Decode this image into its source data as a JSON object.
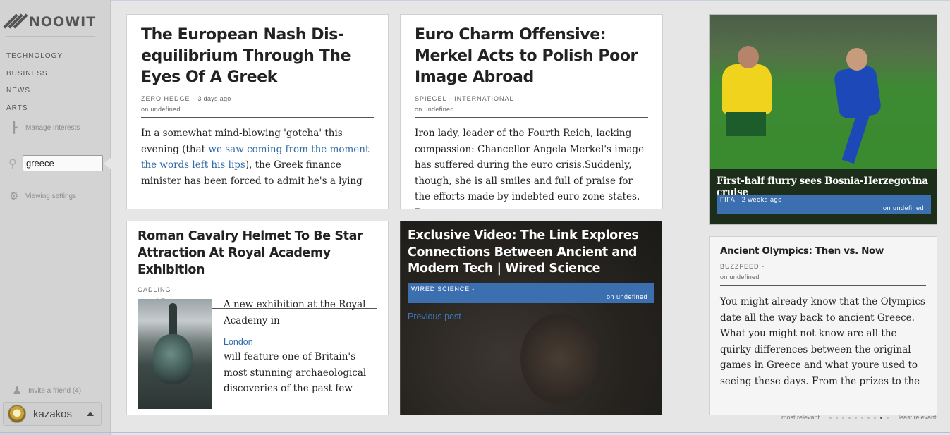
{
  "app": {
    "logo_text": "NOOWIT"
  },
  "sidebar": {
    "nav": [
      "TECHNOLOGY",
      "BUSINESS",
      "NEWS",
      "ARTS"
    ],
    "manage_interests": "Manage Interests",
    "search": {
      "value": "greece",
      "placeholder": ""
    },
    "viewing_settings": "Viewing settings",
    "invite": "Invite a friend (4)",
    "user": "kazakos"
  },
  "articles": [
    {
      "title": "The European Nash Dis-equilibrium Through The Eyes Of A Greek",
      "source": "ZERO HEDGE -",
      "time": "3 days ago",
      "date": "on undefined",
      "body_before": "In a somewhat mind-blowing 'gotcha' this evening (that ",
      "body_link": "we saw coming from the moment the words left his lips",
      "body_after": "), the Greek finance minister has been forced to admit he's a lying"
    },
    {
      "title": "Euro Charm Offensive: Merkel Acts to Polish Poor Image Abroad",
      "source": "SPIEGEL - INTERNATIONAL -",
      "date": "on undefined",
      "body": "Iron lady, leader of the Fourth Reich, lacking compassion: Chancellor Angela Merkel's image has suffered during the euro crisis.Suddenly, though, she is all smiles and full of praise for the efforts made by indebted euro-zone states. But"
    },
    {
      "title": "Roman Cavalry Helmet To Be Star Attraction At Royal Academy Exhibition",
      "source": "GADLING -",
      "date": "on undefined",
      "body_before": "A new exhibition at the Royal Academy in",
      "body_link": "London",
      "body_after": "will feature one of Britain's most stunning archaeological discoveries of the past few"
    },
    {
      "title": "Exclusive Video: The Link Explores Connections Between Ancient and Modern Tech | Wired Science",
      "source": "WIRED SCIENCE -",
      "date": "on undefined",
      "prev_link": "Previous post"
    },
    {
      "title": "First-half flurry sees Bosnia-Herzegovina cruise",
      "source": "FIFA -",
      "time": "2 weeks ago",
      "date": "on undefined"
    },
    {
      "title": "Ancient Olympics: Then vs. Now",
      "source": "BUZZFEED -",
      "date": "on undefined",
      "body": "You might already know that the Olympics date all the way back to ancient Greece. What you might not know are all the quirky differences between the original games in Greece and what youre used to seeing these days. From the prizes to the"
    }
  ],
  "pager": {
    "left": "most relevant",
    "right": "least relevant",
    "count": 10,
    "active_index": 8
  },
  "colors": {
    "accent_blue": "#3c6fb0",
    "link_blue": "#2f6aa8"
  }
}
